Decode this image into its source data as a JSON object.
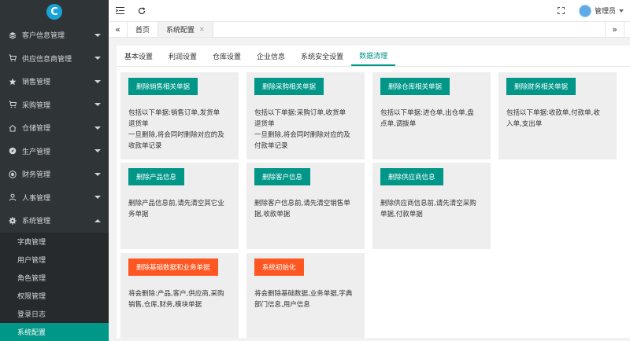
{
  "sidebar": {
    "logo_letter": "C",
    "menu": [
      {
        "label": "客户信息管理",
        "icon": "layers-icon"
      },
      {
        "label": "供应信息商管理",
        "icon": "cart-icon"
      },
      {
        "label": "销售管理",
        "icon": "star-icon"
      },
      {
        "label": "采购管理",
        "icon": "cart-icon"
      },
      {
        "label": "仓储管理",
        "icon": "home-icon"
      },
      {
        "label": "生产管理",
        "icon": "compass-icon"
      },
      {
        "label": "财务管理",
        "icon": "target-icon"
      },
      {
        "label": "人事管理",
        "icon": "user-icon"
      },
      {
        "label": "系统管理",
        "icon": "gear-icon"
      }
    ],
    "submenu": [
      "字典管理",
      "用户管理",
      "角色管理",
      "权限管理",
      "登录日志",
      "系统配置"
    ]
  },
  "topbar": {
    "user_name": "管理员"
  },
  "tabs": {
    "home": "首页",
    "current": "系统配置"
  },
  "subtabs": [
    "基本设置",
    "利润设置",
    "仓库设置",
    "企业信息",
    "系统安全设置",
    "数据清理"
  ],
  "cards": [
    {
      "button": "删除销售相关单据",
      "lines": [
        "包括以下单据:销售订单,发货单",
        "退货单",
        "一旦删除,将会同时删除对应的及",
        "收款单记录"
      ]
    },
    {
      "button": "删除采购相关单据",
      "lines": [
        "包括以下单据:采购订单,收货单",
        "退货单",
        "一旦删除,将会同时删除对应的及",
        "付款单记录"
      ]
    },
    {
      "button": "删除仓库相关单据",
      "lines": [
        "包括以下单据:进仓单,出仓单,盘",
        "点单,调拨单"
      ]
    },
    {
      "button": "删除财务相关单据",
      "lines": [
        "包括以下单据:收款单,付款单,收",
        "入单,支出单"
      ]
    },
    {
      "button": "删除产品信息",
      "lines": [
        "删除产品信息前,请先清空其它业",
        "务单据"
      ]
    },
    {
      "button": "删除客户信息",
      "lines": [
        "删除客户信息前,请先清空销售单",
        "据,收款单据"
      ]
    },
    {
      "button": "删除供应商信息",
      "lines": [
        "删除供应商信息前,请先清空采购",
        "单据,付款单据"
      ]
    },
    {
      "button": "删除基础数据和业务单据",
      "lines": [
        "将会删除:产品,客户,供应商,采购",
        "销售,仓库,财务,模块单据"
      ]
    },
    {
      "button": "系统初始化",
      "lines": [
        "将会删除基础数据,业务单据,字典",
        "部门信息,用户信息"
      ]
    }
  ],
  "colors": {
    "primary": "#009688",
    "danger": "#ff5722",
    "sidebar": "#2f3437"
  }
}
